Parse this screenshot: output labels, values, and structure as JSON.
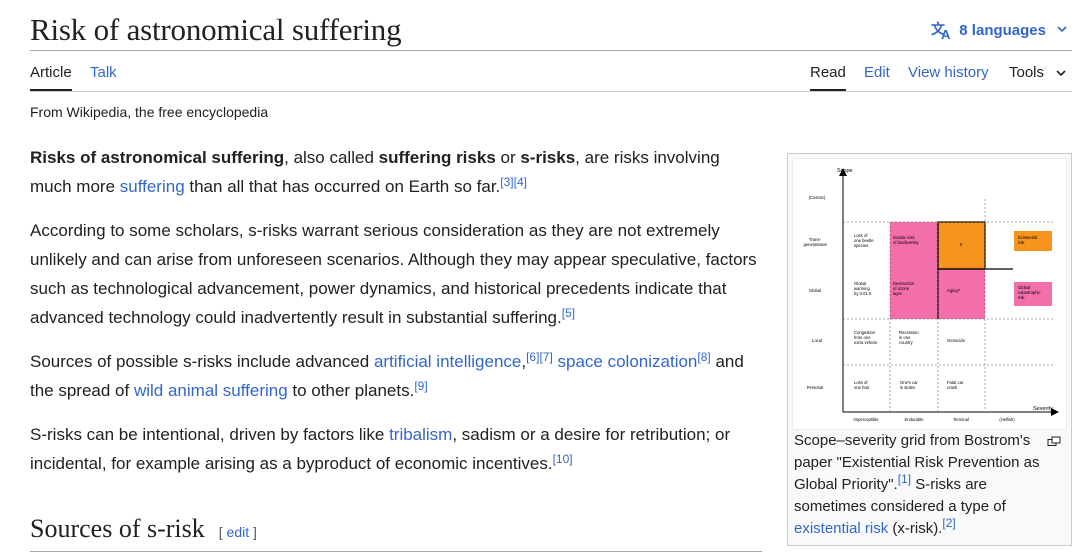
{
  "page": {
    "title": "Risk of astronomical suffering",
    "languages_label": "8 languages",
    "tagline": "From Wikipedia, the free encyclopedia"
  },
  "tabs": {
    "article": "Article",
    "talk": "Talk",
    "read": "Read",
    "edit": "Edit",
    "view_history": "View history",
    "tools": "Tools"
  },
  "content": {
    "p1": {
      "b1": "Risks of astronomical suffering",
      "t1": ", also called ",
      "b2": "suffering risks",
      "t2": " or ",
      "b3": "s-risks",
      "t3": ", are risks involving much more ",
      "link1": "suffering",
      "t4": " than all that has occurred on Earth so far.",
      "ref1": "[3]",
      "ref2": "[4]"
    },
    "p2": {
      "text": "According to some scholars, s-risks warrant serious consideration as they are not extremely unlikely and can arise from unforeseen scenarios. Although they may appear speculative, factors such as technological advancement, power dynamics, and historical precedents indicate that advanced technology could inadvertently result in substantial suffering.",
      "ref1": "[5]"
    },
    "p3": {
      "t1": "Sources of possible s-risks include advanced ",
      "link1": "artificial intelligence",
      "t2": ",",
      "ref1": "[6]",
      "ref2": "[7]",
      "t3": " ",
      "link2": "space colonization",
      "ref3": "[8]",
      "t4": " and the spread of ",
      "link3": "wild animal suffering",
      "t5": " to other planets.",
      "ref4": "[9]"
    },
    "p4": {
      "t1": "S-risks can be intentional, driven by factors like ",
      "link1": "tribalism",
      "t2": ", sadism or a desire for retribution; or incidental, for example arising as a byproduct of economic incentives.",
      "ref1": "[10]"
    },
    "section_heading": "Sources of s-risk",
    "edit_open": "[ ",
    "edit_link": "edit",
    "edit_close": " ]"
  },
  "figure": {
    "caption": {
      "t1": "Scope–severity grid from Bostrom's paper \"Existential Risk Prevention as Global Priority\".",
      "ref1": "[1]",
      "t2": " S-risks are sometimes considered a type of ",
      "link1": "existential risk",
      "t3": " (x-risk).",
      "ref2": "[2]"
    },
    "diagram": {
      "y_axis_label": "Scope",
      "x_axis_label": "Severity",
      "rows": [
        "(Cosmic)",
        "Trans-\ngenerational",
        "Global",
        "Local",
        "Personal"
      ],
      "cols": [
        "Imperceptible",
        "Endurable",
        "Terminal",
        "(Hellish)"
      ],
      "cells": {
        "trans_imperceptible": "Loss of\none beetle\nspecies",
        "trans_endurable": "Drastic loss\nof biodiversity",
        "trans_terminal": "X",
        "global_imperceptible": "Global\nwarming\nby 0.01 K",
        "global_endurable": "Destruction\nof ozone\nlayer",
        "global_terminal": "Aging?",
        "local_imperceptible": "Congestion\nfrom one\nextra vehicle",
        "local_endurable": "Recession\nin one\ncountry",
        "local_terminal": "Genocide",
        "personal_imperceptible": "Loss of\none hair",
        "personal_endurable": "One's car\nis stolen",
        "personal_terminal": "Fatal car\ncrash"
      },
      "legend": {
        "existential": "Existential\nrisk",
        "global_catastrophic": "Global\ncatastrophic\nrisk"
      },
      "colors": {
        "existential": "#f7941d",
        "global_catastrophic": "#f26fa9"
      }
    }
  },
  "colors": {
    "link": "#3366cc",
    "text": "#202122",
    "rule": "#a2a9b1"
  }
}
